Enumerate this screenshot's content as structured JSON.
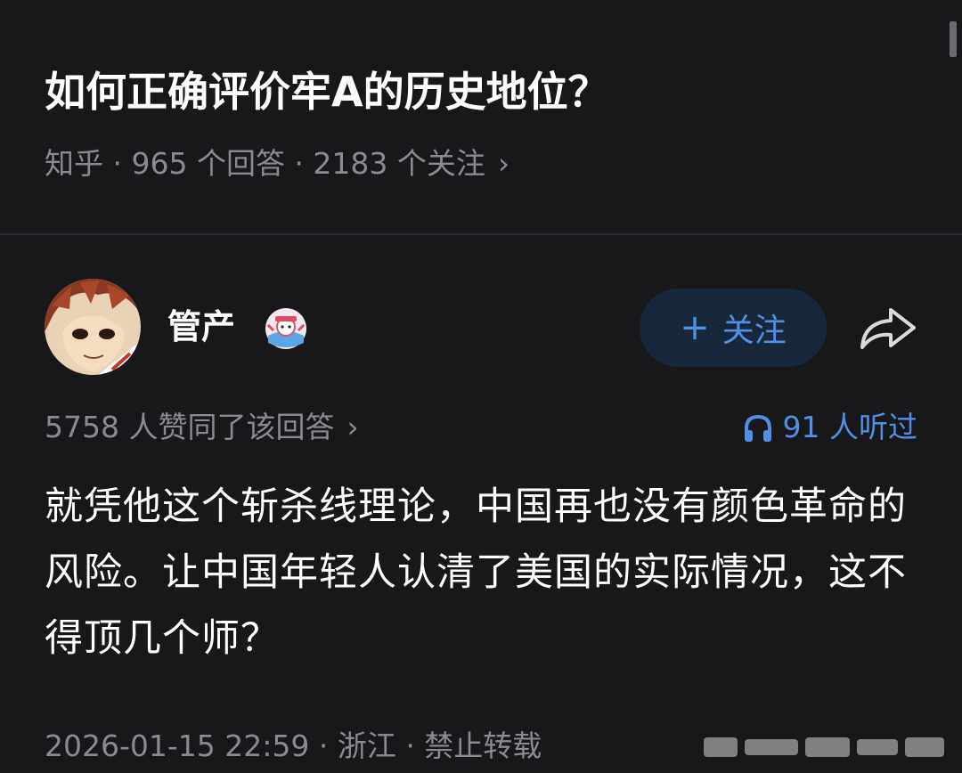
{
  "question": {
    "title": "如何正确评价牢A的历史地位？",
    "meta": "知乎 · 965 个回答 · 2183 个关注",
    "chevron": "›"
  },
  "author": {
    "name": "管产",
    "follow_label": "关注",
    "follow_plus": "+",
    "accent_color": "#4d90e6"
  },
  "stats": {
    "upvotes": "5758 人赞同了该回答",
    "chevron": "›",
    "listened": "91 人听过"
  },
  "answer": {
    "text": "就凭他这个斩杀线理论，中国再也没有颜色革命的风险。让中国年轻人认清了美国的实际情况，这不得顶几个师？"
  },
  "footer": {
    "meta": "2026-01-15 22:59 · 浙江 · 禁止转载"
  },
  "icons": {
    "share": "share-icon",
    "headphones": "headphones-icon",
    "badge": "creator-badge-icon"
  }
}
